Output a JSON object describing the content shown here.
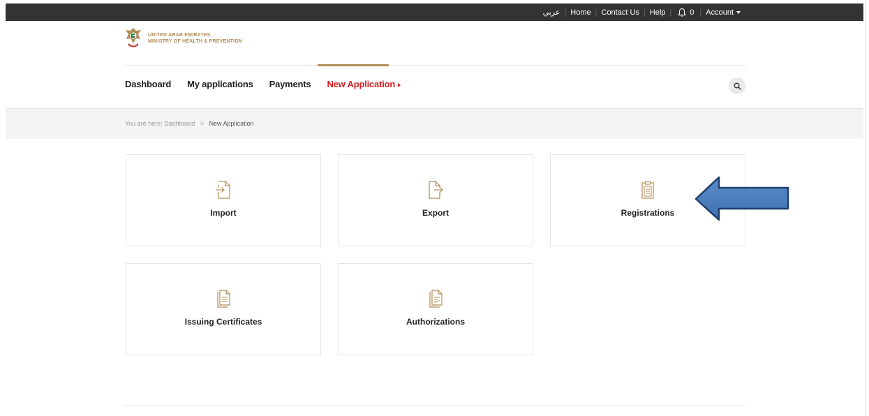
{
  "topbar": {
    "arabic": "عربي",
    "home": "Home",
    "contact": "Contact Us",
    "help": "Help",
    "notifications_count": "0",
    "account": "Account"
  },
  "logo": {
    "line1": "UNITED ARAB EMIRATES",
    "line2": "MINISTRY OF HEALTH & PREVENTION"
  },
  "nav": {
    "items": [
      {
        "label": "Dashboard"
      },
      {
        "label": "My applications"
      },
      {
        "label": "Payments"
      },
      {
        "label": "New Application"
      }
    ]
  },
  "breadcrumb": {
    "prefix": "You are here:",
    "items": [
      "Dashboard",
      "New Application"
    ],
    "separator": ">"
  },
  "cards": [
    {
      "label": "Import",
      "icon": "import-icon"
    },
    {
      "label": "Export",
      "icon": "export-icon"
    },
    {
      "label": "Registrations",
      "icon": "clipboard-icon"
    },
    {
      "label": "Issuing Certificates",
      "icon": "document-icon"
    },
    {
      "label": "Authorizations",
      "icon": "document-edit-icon"
    }
  ],
  "colors": {
    "topbar": "#333333",
    "accent_gold": "#b08d57",
    "active_red": "#d61f26",
    "arrow_blue": "#4a78b6"
  }
}
